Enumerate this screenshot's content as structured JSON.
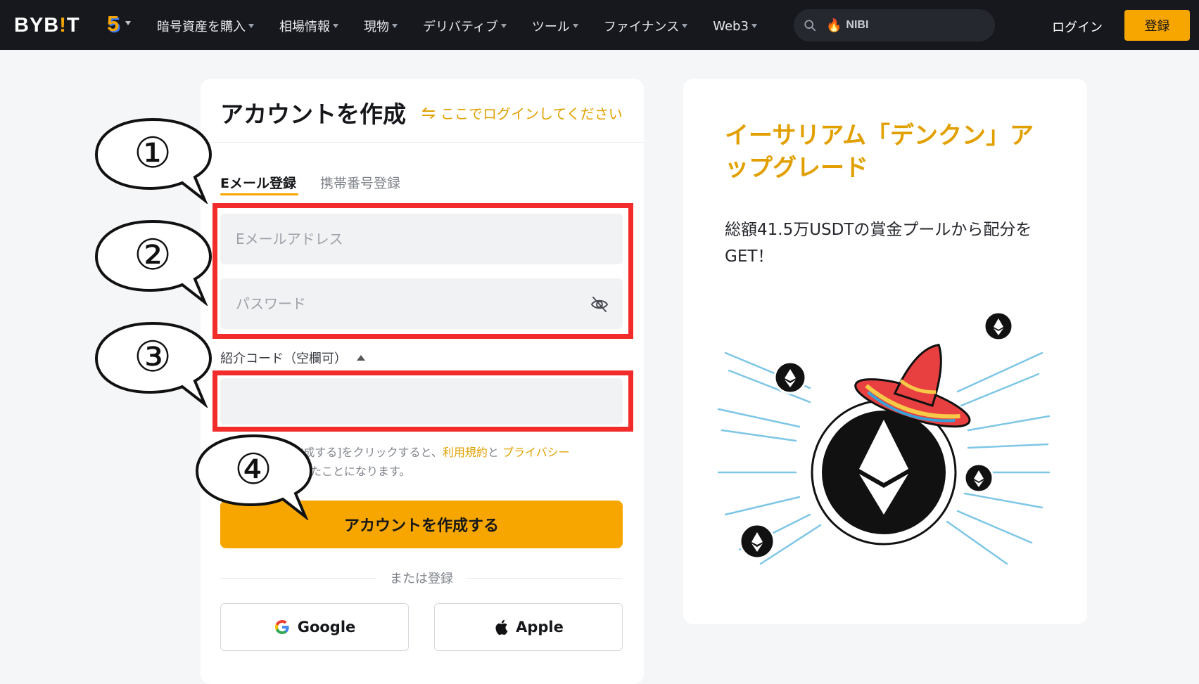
{
  "nav": {
    "logo_main": "BYB",
    "logo_bang": "!",
    "logo_end": "T",
    "five": "5",
    "menu": [
      {
        "label": "暗号資産を購入"
      },
      {
        "label": "相場情報"
      },
      {
        "label": "現物"
      },
      {
        "label": "デリバティブ"
      },
      {
        "label": "ツール"
      },
      {
        "label": "ファイナンス"
      },
      {
        "label": "Web3"
      }
    ],
    "search_query": "NIBI",
    "login": "ログイン",
    "signup": "登録"
  },
  "form": {
    "title": "アカウントを作成",
    "login_here": "ここでログインしてください",
    "tab_email": "Eメール登録",
    "tab_phone": "携帯番号登録",
    "email_placeholder": "Eメールアドレス",
    "password_placeholder": "パスワード",
    "referral_label": "紹介コード（空欄可）",
    "terms_line1_prefix": "[アカウントを作成する]をクリックすると、",
    "terms_link1": "利用規約",
    "terms_and": "と",
    "terms_link2": "プライバシー",
    "terms_line2": "ポリシーに同意したことになります。",
    "create_button": "アカウントを作成する",
    "or_register": "または登録",
    "google": "Google",
    "apple": "Apple"
  },
  "annotations": {
    "b1": "①",
    "b2": "②",
    "b3": "③",
    "b4": "④",
    "highlight_color": "#f22b2b"
  },
  "promo": {
    "title": "イーサリアム「デンクン」アップグレード",
    "subtitle": "総額41.5万USDTの賞金プールから配分をGET！"
  },
  "colors": {
    "accent": "#f7a600",
    "nav_bg": "#17181e"
  }
}
